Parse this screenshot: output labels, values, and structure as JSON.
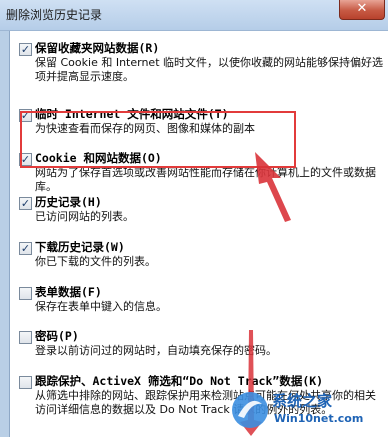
{
  "window": {
    "title": "删除浏览历史记录",
    "close_glyph": "✕"
  },
  "options": [
    {
      "checked": true,
      "label": "保留收藏夹网站数据(R)",
      "description": "保留 Cookie 和 Internet 临时文件，以使你收藏的网站能够保持偏好选项并提高显示速度。"
    },
    {
      "checked": true,
      "label": "临时 Internet 文件和网站文件(T)",
      "description": "为快速查看而保存的网页、图像和媒体的副本"
    },
    {
      "checked": true,
      "label": "Cookie 和网站数据(O)",
      "description": "网站为了保存首选项或改善网站性能而存储在你计算机上的文件或数据库。"
    },
    {
      "checked": true,
      "label": "历史记录(H)",
      "description": "已访问网站的列表。"
    },
    {
      "checked": true,
      "label": "下载历史记录(W)",
      "description": "你已下载的文件的列表。"
    },
    {
      "checked": false,
      "label": "表单数据(F)",
      "description": "保存在表单中键入的信息。"
    },
    {
      "checked": false,
      "label": "密码(P)",
      "description": "登录以前访问过的网站时，自动填充保存的密码。"
    },
    {
      "checked": false,
      "label": "跟踪保护、ActiveX 筛选和“Do Not Track”数据(K)",
      "description": "从筛选中排除的网站、跟踪保护用来检测站点可能在何处共享你的相关访问详细信息的数据以及 Do Not Track 请求的例外的列表。"
    }
  ],
  "watermark": {
    "text": "系统之家",
    "sub": "Win10net.com"
  },
  "colors": {
    "highlight": "#e23b3b",
    "arrow": "#d9333a"
  }
}
